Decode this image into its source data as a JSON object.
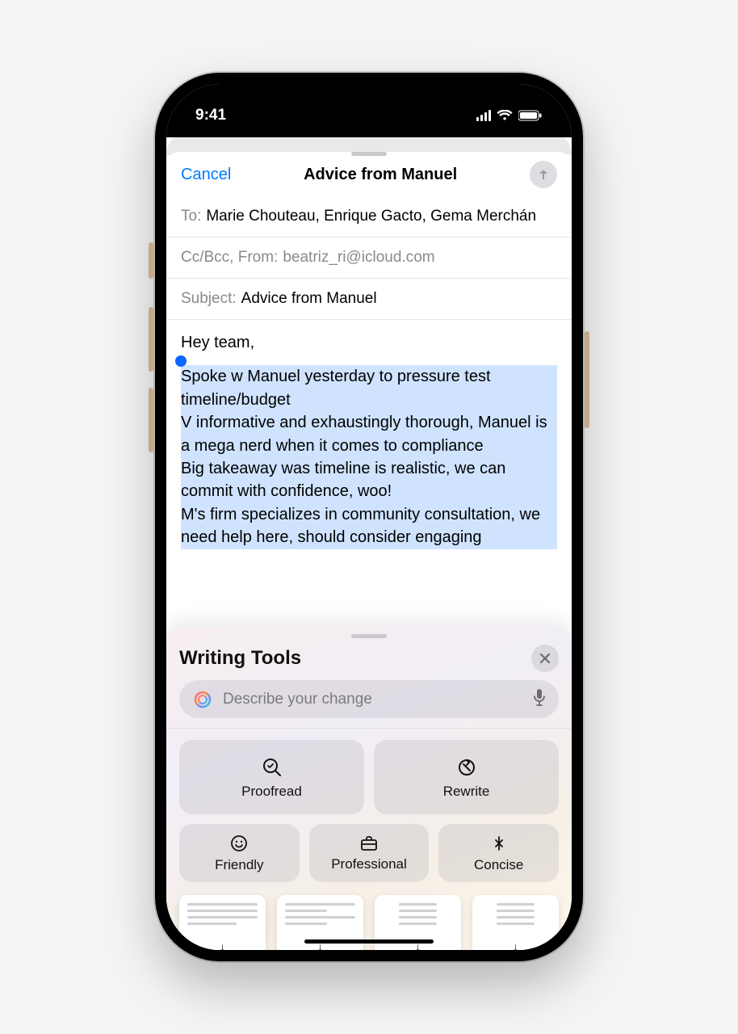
{
  "status": {
    "time": "9:41"
  },
  "compose": {
    "cancel": "Cancel",
    "title": "Advice from Manuel",
    "to_label": "To:",
    "recipients": "Marie Chouteau, Enrique Gacto, Gema Merchán",
    "ccbcc_label": "Cc/Bcc, From:",
    "from_value": "beatriz_ri@icloud.com",
    "subject_label": "Subject:",
    "subject_value": "Advice from Manuel",
    "greeting": "Hey team,",
    "selected_text": "Spoke w Manuel yesterday to pressure test timeline/budget\nV informative and exhaustingly thorough, Manuel is a mega nerd when it comes to compliance\nBig takeaway was timeline is realistic, we can commit with confidence, woo!\nM's firm specializes in community consultation, we need help here, should consider engaging"
  },
  "writing_tools": {
    "title": "Writing Tools",
    "placeholder": "Describe your change",
    "buttons": {
      "proofread": "Proofread",
      "rewrite": "Rewrite",
      "friendly": "Friendly",
      "professional": "Professional",
      "concise": "Concise"
    }
  }
}
